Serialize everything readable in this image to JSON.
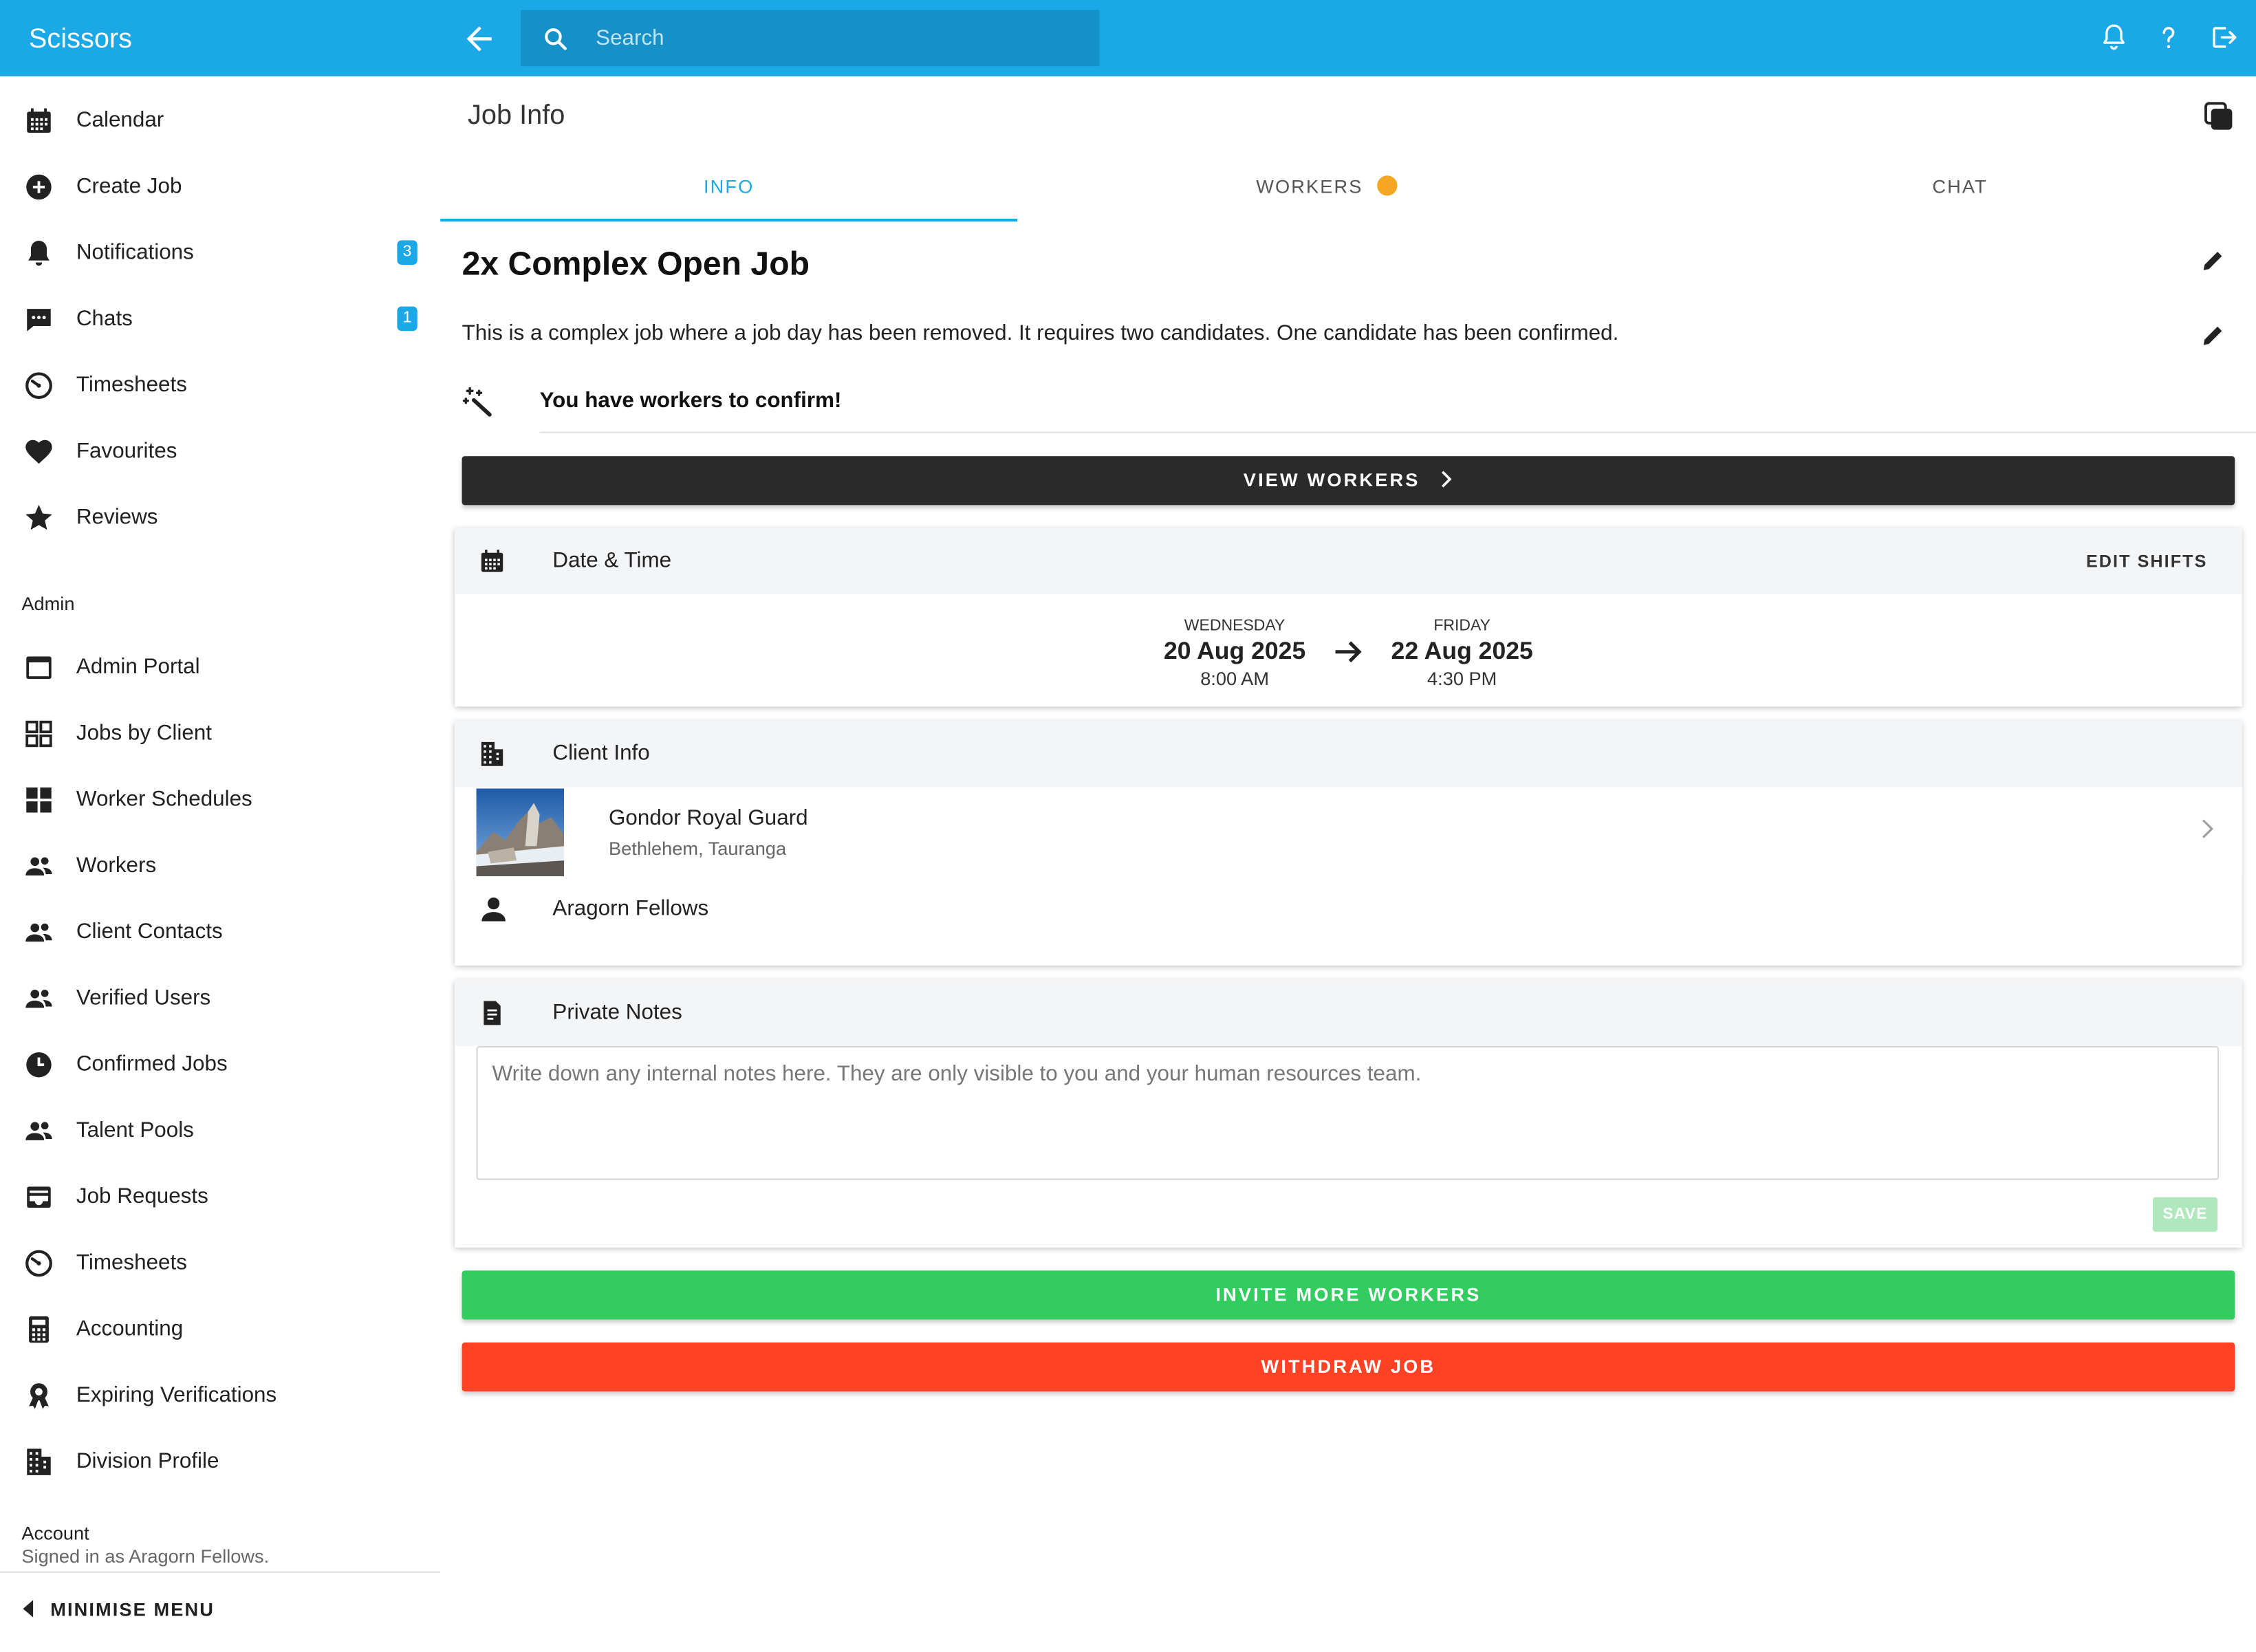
{
  "app": {
    "title": "Scissors"
  },
  "search": {
    "placeholder": "Search"
  },
  "sidebar": {
    "main_items": [
      {
        "label": "Calendar",
        "icon": "calendar-icon"
      },
      {
        "label": "Create Job",
        "icon": "add-circle-icon"
      },
      {
        "label": "Notifications",
        "icon": "bell-icon",
        "badge": "3"
      },
      {
        "label": "Chats",
        "icon": "chat-icon",
        "badge": "1"
      },
      {
        "label": "Timesheets",
        "icon": "timer-icon"
      },
      {
        "label": "Favourites",
        "icon": "heart-icon"
      },
      {
        "label": "Reviews",
        "icon": "star-icon"
      }
    ],
    "admin_heading": "Admin",
    "admin_items": [
      {
        "label": "Admin Portal",
        "icon": "browser-icon"
      },
      {
        "label": "Jobs by Client",
        "icon": "grid-outline-icon"
      },
      {
        "label": "Worker Schedules",
        "icon": "dashboard-icon"
      },
      {
        "label": "Workers",
        "icon": "people-icon"
      },
      {
        "label": "Client Contacts",
        "icon": "people-icon"
      },
      {
        "label": "Verified Users",
        "icon": "people-icon"
      },
      {
        "label": "Confirmed Jobs",
        "icon": "clock-icon"
      },
      {
        "label": "Talent Pools",
        "icon": "people-icon"
      },
      {
        "label": "Job Requests",
        "icon": "inbox-icon"
      },
      {
        "label": "Timesheets",
        "icon": "timer-icon"
      },
      {
        "label": "Accounting",
        "icon": "calculator-icon"
      },
      {
        "label": "Expiring Verifications",
        "icon": "award-icon"
      },
      {
        "label": "Division Profile",
        "icon": "building-icon"
      }
    ],
    "account_heading": "Account",
    "signed_in": "Signed in as Aragorn Fellows.",
    "minimise_label": "MINIMISE MENU"
  },
  "page": {
    "title": "Job Info",
    "tabs": [
      {
        "label": "INFO",
        "active": true
      },
      {
        "label": "WORKERS",
        "active": false
      },
      {
        "label": "CHAT",
        "active": false
      }
    ]
  },
  "job": {
    "title": "2x Complex Open Job",
    "description": "This is a complex job where a job day has been removed. It requires two candidates. One candidate has been confirmed.",
    "confirm_notice": "You have workers to confirm!",
    "view_workers_label": "VIEW WORKERS"
  },
  "date_time": {
    "heading": "Date & Time",
    "edit_label": "EDIT SHIFTS",
    "start": {
      "day": "WEDNESDAY",
      "date": "20 Aug 2025",
      "time": "8:00 AM"
    },
    "end": {
      "day": "FRIDAY",
      "date": "22 Aug 2025",
      "time": "4:30 PM"
    }
  },
  "client": {
    "heading": "Client Info",
    "name": "Gondor Royal Guard",
    "location": "Bethlehem, Tauranga",
    "contact": "Aragorn Fellows"
  },
  "notes": {
    "heading": "Private Notes",
    "placeholder": "Write down any internal notes here. They are only visible to you and your human resources team.",
    "value": "",
    "save_label": "SAVE"
  },
  "actions": {
    "invite_label": "INVITE MORE WORKERS",
    "withdraw_label": "WITHDRAW JOB"
  },
  "colors": {
    "header": "#1aa8e6",
    "invite": "#33cc5e",
    "withdraw": "#ff4225",
    "dark_button": "#2a2a2a",
    "workers_dot": "#f5a623"
  }
}
